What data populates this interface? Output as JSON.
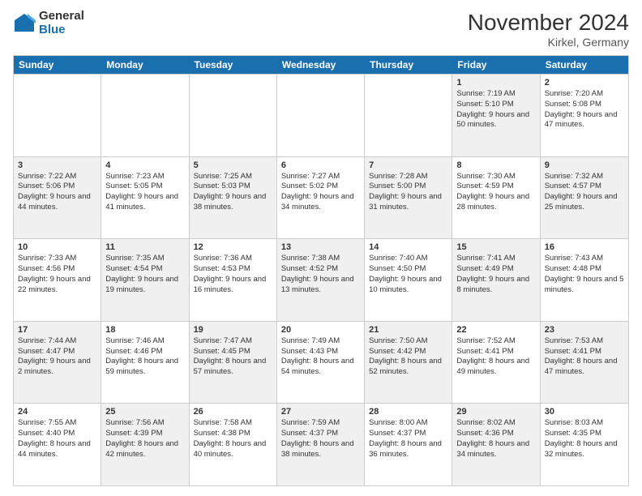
{
  "logo": {
    "general": "General",
    "blue": "Blue"
  },
  "header": {
    "month": "November 2024",
    "location": "Kirkel, Germany"
  },
  "days": [
    "Sunday",
    "Monday",
    "Tuesday",
    "Wednesday",
    "Thursday",
    "Friday",
    "Saturday"
  ],
  "weeks": [
    [
      {
        "day": "",
        "info": "",
        "shaded": false,
        "empty": true
      },
      {
        "day": "",
        "info": "",
        "shaded": false,
        "empty": true
      },
      {
        "day": "",
        "info": "",
        "shaded": false,
        "empty": true
      },
      {
        "day": "",
        "info": "",
        "shaded": false,
        "empty": true
      },
      {
        "day": "",
        "info": "",
        "shaded": false,
        "empty": true
      },
      {
        "day": "1",
        "info": "Sunrise: 7:19 AM\nSunset: 5:10 PM\nDaylight: 9 hours and 50 minutes.",
        "shaded": true
      },
      {
        "day": "2",
        "info": "Sunrise: 7:20 AM\nSunset: 5:08 PM\nDaylight: 9 hours and 47 minutes.",
        "shaded": false
      }
    ],
    [
      {
        "day": "3",
        "info": "Sunrise: 7:22 AM\nSunset: 5:06 PM\nDaylight: 9 hours and 44 minutes.",
        "shaded": true
      },
      {
        "day": "4",
        "info": "Sunrise: 7:23 AM\nSunset: 5:05 PM\nDaylight: 9 hours and 41 minutes.",
        "shaded": false
      },
      {
        "day": "5",
        "info": "Sunrise: 7:25 AM\nSunset: 5:03 PM\nDaylight: 9 hours and 38 minutes.",
        "shaded": true
      },
      {
        "day": "6",
        "info": "Sunrise: 7:27 AM\nSunset: 5:02 PM\nDaylight: 9 hours and 34 minutes.",
        "shaded": false
      },
      {
        "day": "7",
        "info": "Sunrise: 7:28 AM\nSunset: 5:00 PM\nDaylight: 9 hours and 31 minutes.",
        "shaded": true
      },
      {
        "day": "8",
        "info": "Sunrise: 7:30 AM\nSunset: 4:59 PM\nDaylight: 9 hours and 28 minutes.",
        "shaded": false
      },
      {
        "day": "9",
        "info": "Sunrise: 7:32 AM\nSunset: 4:57 PM\nDaylight: 9 hours and 25 minutes.",
        "shaded": true
      }
    ],
    [
      {
        "day": "10",
        "info": "Sunrise: 7:33 AM\nSunset: 4:56 PM\nDaylight: 9 hours and 22 minutes.",
        "shaded": false
      },
      {
        "day": "11",
        "info": "Sunrise: 7:35 AM\nSunset: 4:54 PM\nDaylight: 9 hours and 19 minutes.",
        "shaded": true
      },
      {
        "day": "12",
        "info": "Sunrise: 7:36 AM\nSunset: 4:53 PM\nDaylight: 9 hours and 16 minutes.",
        "shaded": false
      },
      {
        "day": "13",
        "info": "Sunrise: 7:38 AM\nSunset: 4:52 PM\nDaylight: 9 hours and 13 minutes.",
        "shaded": true
      },
      {
        "day": "14",
        "info": "Sunrise: 7:40 AM\nSunset: 4:50 PM\nDaylight: 9 hours and 10 minutes.",
        "shaded": false
      },
      {
        "day": "15",
        "info": "Sunrise: 7:41 AM\nSunset: 4:49 PM\nDaylight: 9 hours and 8 minutes.",
        "shaded": true
      },
      {
        "day": "16",
        "info": "Sunrise: 7:43 AM\nSunset: 4:48 PM\nDaylight: 9 hours and 5 minutes.",
        "shaded": false
      }
    ],
    [
      {
        "day": "17",
        "info": "Sunrise: 7:44 AM\nSunset: 4:47 PM\nDaylight: 9 hours and 2 minutes.",
        "shaded": true
      },
      {
        "day": "18",
        "info": "Sunrise: 7:46 AM\nSunset: 4:46 PM\nDaylight: 8 hours and 59 minutes.",
        "shaded": false
      },
      {
        "day": "19",
        "info": "Sunrise: 7:47 AM\nSunset: 4:45 PM\nDaylight: 8 hours and 57 minutes.",
        "shaded": true
      },
      {
        "day": "20",
        "info": "Sunrise: 7:49 AM\nSunset: 4:43 PM\nDaylight: 8 hours and 54 minutes.",
        "shaded": false
      },
      {
        "day": "21",
        "info": "Sunrise: 7:50 AM\nSunset: 4:42 PM\nDaylight: 8 hours and 52 minutes.",
        "shaded": true
      },
      {
        "day": "22",
        "info": "Sunrise: 7:52 AM\nSunset: 4:41 PM\nDaylight: 8 hours and 49 minutes.",
        "shaded": false
      },
      {
        "day": "23",
        "info": "Sunrise: 7:53 AM\nSunset: 4:41 PM\nDaylight: 8 hours and 47 minutes.",
        "shaded": true
      }
    ],
    [
      {
        "day": "24",
        "info": "Sunrise: 7:55 AM\nSunset: 4:40 PM\nDaylight: 8 hours and 44 minutes.",
        "shaded": false
      },
      {
        "day": "25",
        "info": "Sunrise: 7:56 AM\nSunset: 4:39 PM\nDaylight: 8 hours and 42 minutes.",
        "shaded": true
      },
      {
        "day": "26",
        "info": "Sunrise: 7:58 AM\nSunset: 4:38 PM\nDaylight: 8 hours and 40 minutes.",
        "shaded": false
      },
      {
        "day": "27",
        "info": "Sunrise: 7:59 AM\nSunset: 4:37 PM\nDaylight: 8 hours and 38 minutes.",
        "shaded": true
      },
      {
        "day": "28",
        "info": "Sunrise: 8:00 AM\nSunset: 4:37 PM\nDaylight: 8 hours and 36 minutes.",
        "shaded": false
      },
      {
        "day": "29",
        "info": "Sunrise: 8:02 AM\nSunset: 4:36 PM\nDaylight: 8 hours and 34 minutes.",
        "shaded": true
      },
      {
        "day": "30",
        "info": "Sunrise: 8:03 AM\nSunset: 4:35 PM\nDaylight: 8 hours and 32 minutes.",
        "shaded": false
      }
    ]
  ]
}
